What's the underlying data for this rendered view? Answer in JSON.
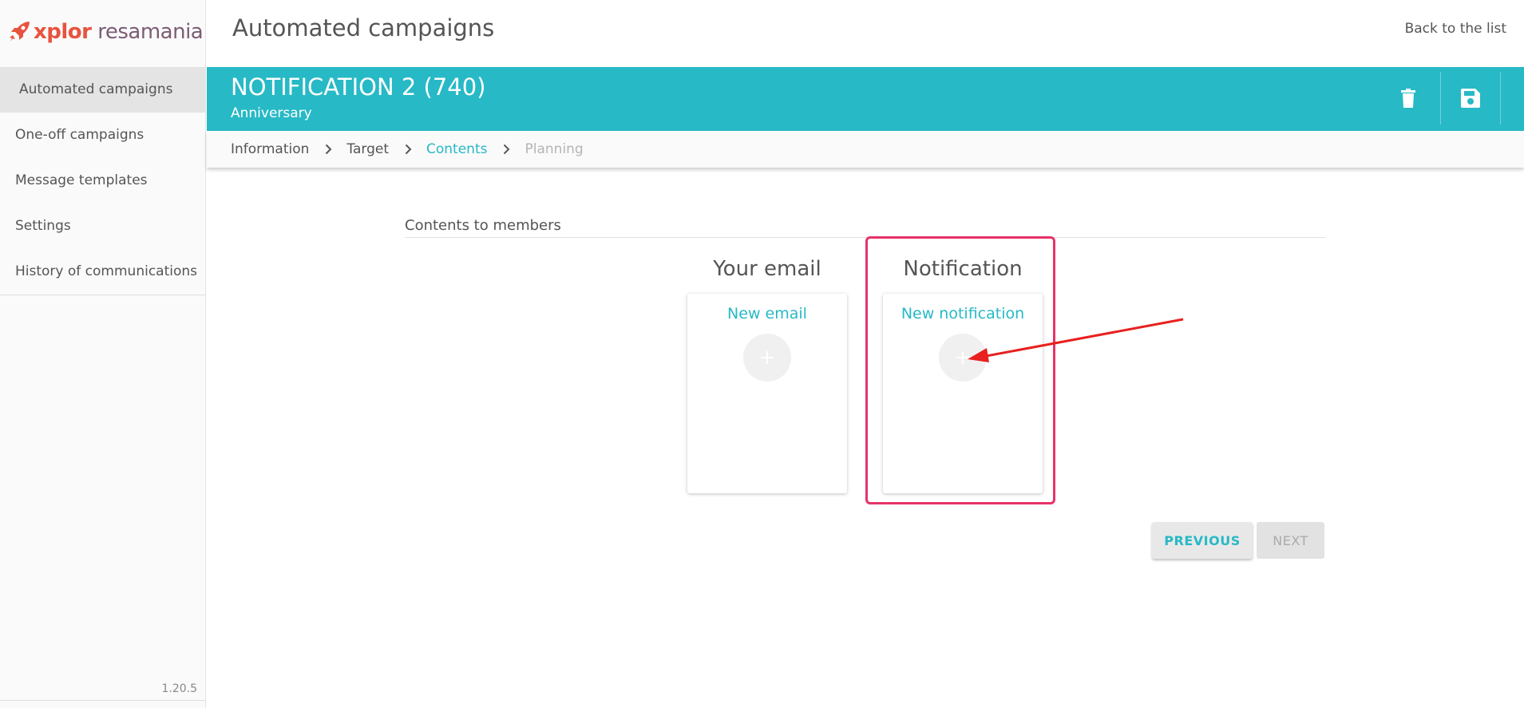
{
  "brand": {
    "logo_part1": "xplor",
    "logo_part2": "resamania",
    "accent": "#e8533f"
  },
  "sidebar": {
    "items": [
      {
        "label": "Automated campaigns",
        "active": true
      },
      {
        "label": "One-off campaigns"
      },
      {
        "label": "Message templates"
      },
      {
        "label": "Settings"
      },
      {
        "label": "History of communications"
      }
    ],
    "version": "1.20.5"
  },
  "header": {
    "title": "Automated campaigns",
    "back_label": "Back to the list"
  },
  "campaign": {
    "title": "NOTIFICATION 2 (740)",
    "subtitle": "Anniversary",
    "actions": [
      "trash-icon",
      "save-icon"
    ],
    "color": "#27b9c6"
  },
  "steps": [
    {
      "label": "Information",
      "state": "done"
    },
    {
      "label": "Target",
      "state": "done"
    },
    {
      "label": "Contents",
      "state": "current"
    },
    {
      "label": "Planning",
      "state": "disabled"
    }
  ],
  "contents": {
    "section_title": "Contents to members",
    "email": {
      "title": "Your email",
      "link": "New email"
    },
    "notification": {
      "title": "Notification",
      "link": "New notification"
    }
  },
  "buttons": {
    "previous": "PREVIOUS",
    "next": "NEXT"
  },
  "annotation": {
    "highlight_color": "#e6336a",
    "arrow_color": "#e8201f"
  }
}
